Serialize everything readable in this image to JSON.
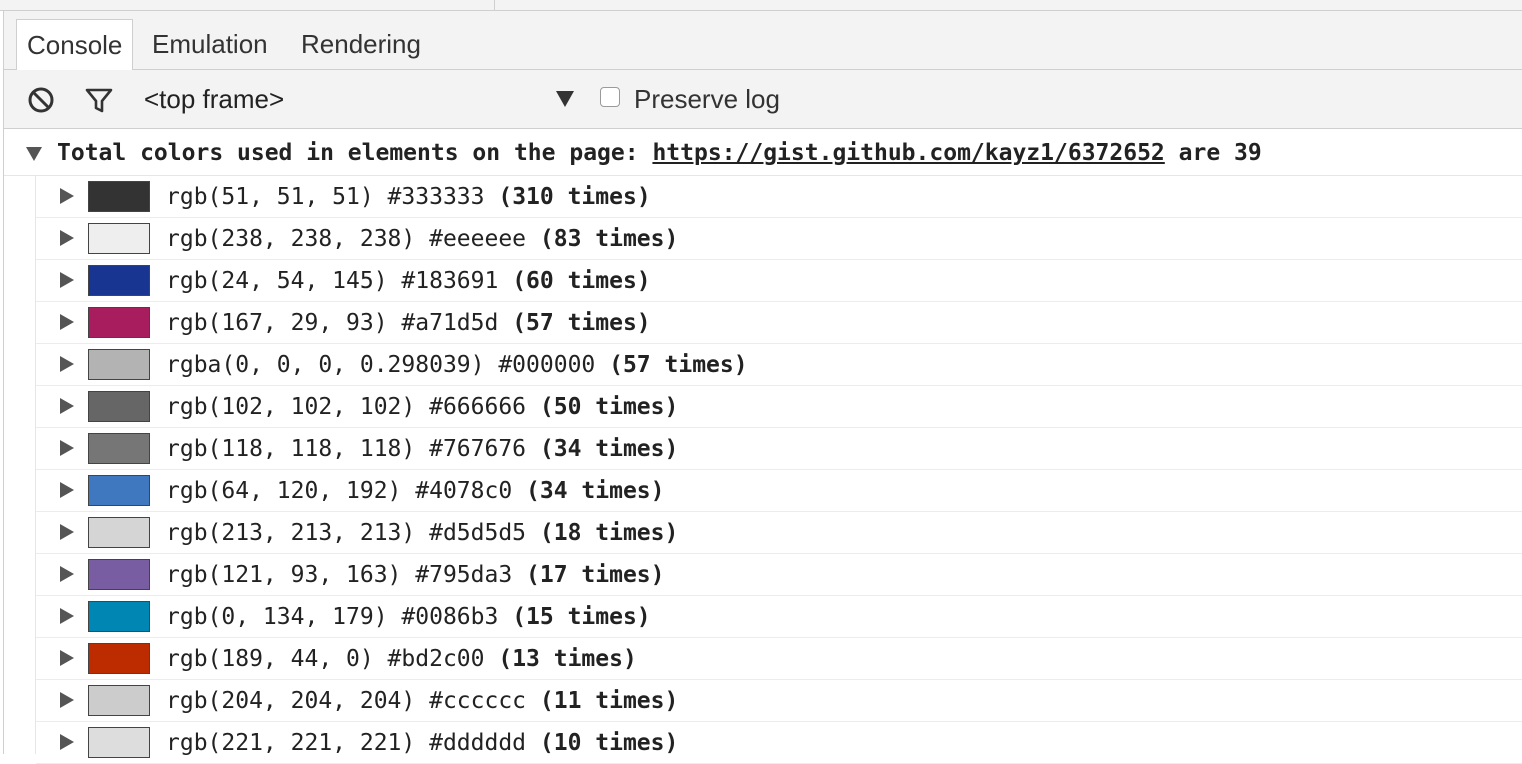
{
  "tabs": [
    {
      "label": "Console",
      "active": true
    },
    {
      "label": "Emulation",
      "active": false
    },
    {
      "label": "Rendering",
      "active": false
    }
  ],
  "toolbar": {
    "frame_label": "<top frame>",
    "preserve_log_label": "Preserve log",
    "preserve_log_checked": false
  },
  "group": {
    "prefix": "Total colors used in elements on the page: ",
    "link": "https://gist.github.com/kayz1/6372652",
    "suffix": " are 39"
  },
  "colors": [
    {
      "text": "rgb(51, 51, 51) #333333 ",
      "times": "(310 times)",
      "swatch": "#333333"
    },
    {
      "text": "rgb(238, 238, 238) #eeeeee ",
      "times": "(83 times)",
      "swatch": "#eeeeee"
    },
    {
      "text": "rgb(24, 54, 145) #183691 ",
      "times": "(60 times)",
      "swatch": "#183691"
    },
    {
      "text": "rgb(167, 29, 93) #a71d5d ",
      "times": "(57 times)",
      "swatch": "#a71d5d"
    },
    {
      "text": "rgba(0, 0, 0, 0.298039) #000000 ",
      "times": "(57 times)",
      "swatch": "#b3b3b3"
    },
    {
      "text": "rgb(102, 102, 102) #666666 ",
      "times": "(50 times)",
      "swatch": "#666666"
    },
    {
      "text": "rgb(118, 118, 118) #767676 ",
      "times": "(34 times)",
      "swatch": "#767676"
    },
    {
      "text": "rgb(64, 120, 192) #4078c0 ",
      "times": "(34 times)",
      "swatch": "#4078c0"
    },
    {
      "text": "rgb(213, 213, 213) #d5d5d5 ",
      "times": "(18 times)",
      "swatch": "#d5d5d5"
    },
    {
      "text": "rgb(121, 93, 163) #795da3 ",
      "times": "(17 times)",
      "swatch": "#795da3"
    },
    {
      "text": "rgb(0, 134, 179) #0086b3 ",
      "times": "(15 times)",
      "swatch": "#0086b3"
    },
    {
      "text": "rgb(189, 44, 0) #bd2c00 ",
      "times": "(13 times)",
      "swatch": "#bd2c00"
    },
    {
      "text": "rgb(204, 204, 204) #cccccc ",
      "times": "(11 times)",
      "swatch": "#cccccc"
    },
    {
      "text": "rgb(221, 221, 221) #dddddd ",
      "times": "(10 times)",
      "swatch": "#dddddd"
    }
  ]
}
